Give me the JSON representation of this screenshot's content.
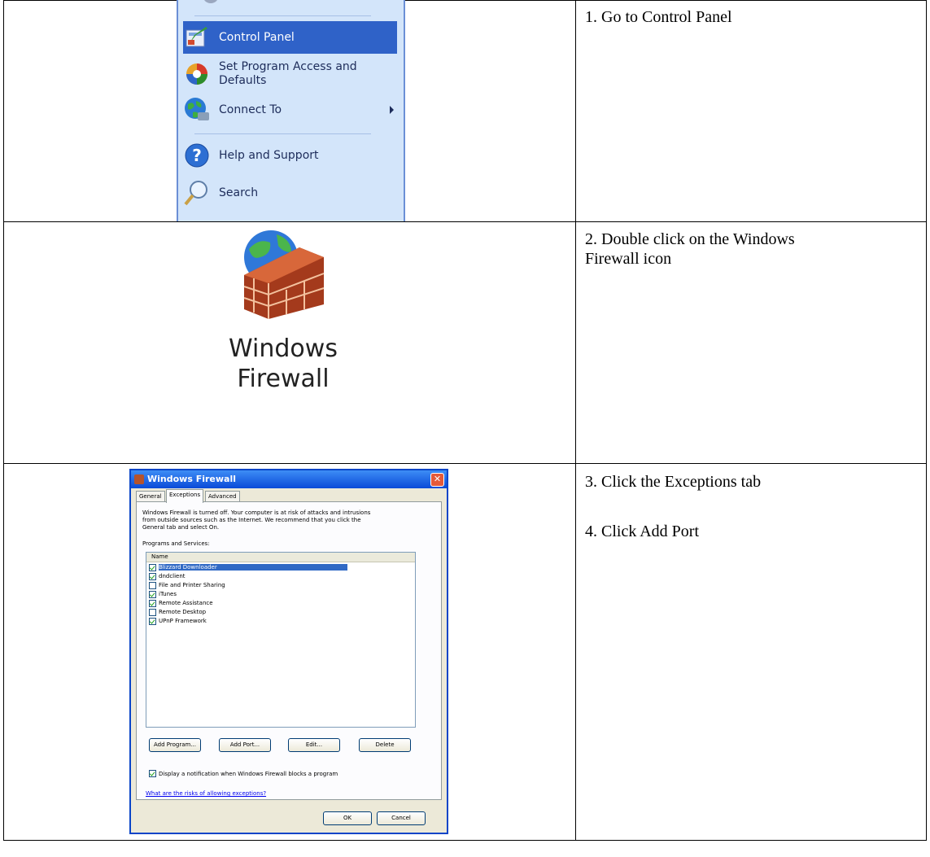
{
  "steps": [
    "1. Go to Control Panel",
    "2. Double click on the Windows\nFirewall icon",
    "3. Click the Exceptions tab",
    "4. Click Add Port"
  ],
  "start_menu": {
    "items": [
      {
        "label": "Control Panel",
        "icon": "control-panel-icon",
        "selected": true
      },
      {
        "label": "Set Program Access and\nDefaults",
        "icon": "program-access-icon"
      },
      {
        "label": "Connect To",
        "icon": "connect-to-icon",
        "submenu": true
      },
      {
        "label": "Help and Support",
        "icon": "help-icon"
      },
      {
        "label": "Search",
        "icon": "search-icon"
      }
    ]
  },
  "firewall_icon": {
    "label_line1": "Windows",
    "label_line2": "Firewall"
  },
  "dialog": {
    "title": "Windows Firewall",
    "tabs": [
      "General",
      "Exceptions",
      "Advanced"
    ],
    "active_tab": "Exceptions",
    "warning_line1": "Windows Firewall is turned off. Your computer is at risk of attacks and intrusions",
    "warning_line2": "from outside sources such as the Internet. We recommend that you click the",
    "warning_line3": "General tab and select On.",
    "programs_label": "Programs and Services:",
    "column_name": "Name",
    "programs": [
      {
        "name": "Blizzard Downloader",
        "checked": true,
        "selected": true
      },
      {
        "name": "dndclient",
        "checked": true
      },
      {
        "name": "File and Printer Sharing",
        "checked": false
      },
      {
        "name": "iTunes",
        "checked": true
      },
      {
        "name": "Remote Assistance",
        "checked": true
      },
      {
        "name": "Remote Desktop",
        "checked": false
      },
      {
        "name": "UPnP Framework",
        "checked": true
      }
    ],
    "buttons": {
      "add_program": "Add Program...",
      "add_port": "Add Port...",
      "edit": "Edit...",
      "delete": "Delete",
      "ok": "OK",
      "cancel": "Cancel"
    },
    "notify_label": "Display a notification when Windows Firewall blocks a program",
    "notify_checked": true,
    "risk_link": "What are the risks of allowing exceptions?"
  },
  "colors": {
    "xp_blue": "#0a45c8",
    "menu_selected": "#2f62c8",
    "dialog_bg": "#ece9d8"
  }
}
